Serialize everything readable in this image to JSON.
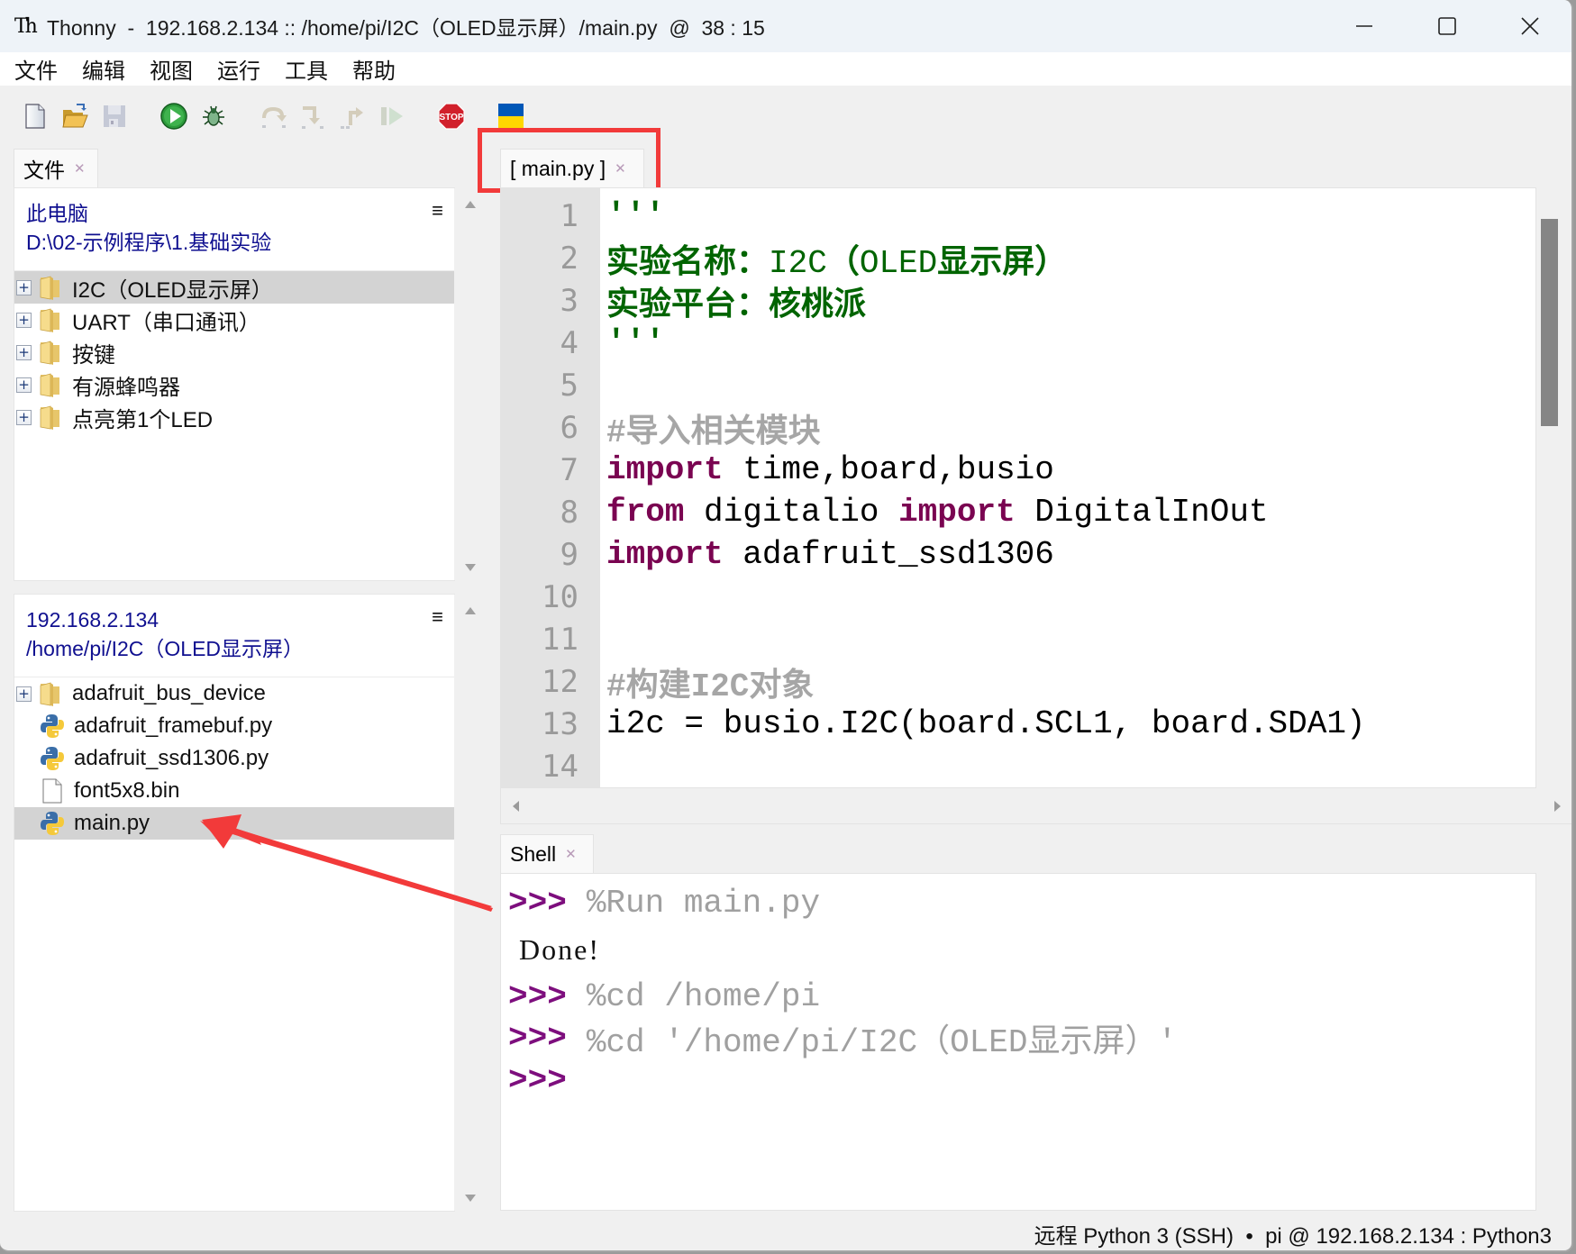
{
  "window": {
    "app_name": "Thonny",
    "title": "Thonny  -  192.168.2.134 :: /home/pi/I2C（OLED显示屏）/main.py  @  38 : 15",
    "controls": [
      "minimize",
      "maximize",
      "close"
    ]
  },
  "menu": [
    "文件",
    "编辑",
    "视图",
    "运行",
    "工具",
    "帮助"
  ],
  "toolbar": {
    "buttons": [
      {
        "name": "new-file",
        "icon": "new-file-icon",
        "enabled": true
      },
      {
        "name": "open-file",
        "icon": "open-folder-icon",
        "enabled": true
      },
      {
        "name": "save-file",
        "icon": "save-icon",
        "enabled": false
      },
      {
        "name": "run",
        "icon": "run-icon",
        "enabled": true
      },
      {
        "name": "debug",
        "icon": "bug-icon",
        "enabled": true
      },
      {
        "name": "step-over",
        "icon": "step-over-icon",
        "enabled": false
      },
      {
        "name": "step-into",
        "icon": "step-into-icon",
        "enabled": false
      },
      {
        "name": "step-out",
        "icon": "step-out-icon",
        "enabled": false
      },
      {
        "name": "resume",
        "icon": "resume-icon",
        "enabled": false
      },
      {
        "name": "stop",
        "icon": "stop-icon",
        "label": "STOP",
        "enabled": true
      },
      {
        "name": "ukraine-flag",
        "icon": "ukraine-flag-icon",
        "enabled": true
      }
    ]
  },
  "files_panel": {
    "tab_label": "文件",
    "local": {
      "title": "此电脑",
      "path": "D:\\02-示例程序\\1.基础实验",
      "items": [
        {
          "name": "I2C（OLED显示屏）",
          "type": "folder",
          "expandable": true,
          "selected": true
        },
        {
          "name": "UART（串口通讯）",
          "type": "folder",
          "expandable": true,
          "selected": false
        },
        {
          "name": "按键",
          "type": "folder",
          "expandable": true,
          "selected": false
        },
        {
          "name": "有源蜂鸣器",
          "type": "folder",
          "expandable": true,
          "selected": false
        },
        {
          "name": "点亮第1个LED",
          "type": "folder",
          "expandable": true,
          "selected": false
        }
      ]
    },
    "remote": {
      "title": "192.168.2.134",
      "path": "/home/pi/I2C（OLED显示屏）",
      "items": [
        {
          "name": "adafruit_bus_device",
          "type": "folder",
          "expandable": true,
          "selected": false
        },
        {
          "name": "adafruit_framebuf.py",
          "type": "python",
          "expandable": false,
          "selected": false
        },
        {
          "name": "adafruit_ssd1306.py",
          "type": "python",
          "expandable": false,
          "selected": false
        },
        {
          "name": "font5x8.bin",
          "type": "file",
          "expandable": false,
          "selected": false
        },
        {
          "name": "main.py",
          "type": "python",
          "expandable": false,
          "selected": true
        }
      ]
    },
    "menu_icon": "≡"
  },
  "editor": {
    "tab_label": "[ main.py ]",
    "lines": [
      {
        "n": "1",
        "tokens": [
          {
            "t": "'''",
            "c": "str"
          }
        ]
      },
      {
        "n": "2",
        "tokens": [
          {
            "t": "实验名称：",
            "c": "str"
          },
          {
            "t": "I2C",
            "c": "str-plain"
          },
          {
            "t": "（",
            "c": "str"
          },
          {
            "t": "OLED",
            "c": "str-plain"
          },
          {
            "t": "显示屏）",
            "c": "str"
          }
        ]
      },
      {
        "n": "3",
        "tokens": [
          {
            "t": "实验平台：核桃派",
            "c": "str"
          }
        ]
      },
      {
        "n": "4",
        "tokens": [
          {
            "t": "'''",
            "c": "str"
          }
        ]
      },
      {
        "n": "5",
        "tokens": []
      },
      {
        "n": "6",
        "tokens": [
          {
            "t": "#导入相关模块",
            "c": "cm"
          }
        ]
      },
      {
        "n": "7",
        "tokens": [
          {
            "t": "import",
            "c": "kw"
          },
          {
            "t": " time,board,busio",
            "c": ""
          }
        ]
      },
      {
        "n": "8",
        "tokens": [
          {
            "t": "from",
            "c": "kw"
          },
          {
            "t": " digitalio ",
            "c": ""
          },
          {
            "t": "import",
            "c": "kw"
          },
          {
            "t": " DigitalInOut",
            "c": ""
          }
        ]
      },
      {
        "n": "9",
        "tokens": [
          {
            "t": "import",
            "c": "kw"
          },
          {
            "t": " adafruit_ssd1306",
            "c": ""
          }
        ]
      },
      {
        "n": "10",
        "tokens": []
      },
      {
        "n": "11",
        "tokens": []
      },
      {
        "n": "12",
        "tokens": [
          {
            "t": "#构建I2C对象",
            "c": "cm"
          }
        ]
      },
      {
        "n": "13",
        "tokens": [
          {
            "t": "i2c = busio.I2C(board.SCL1, board.SDA1)",
            "c": ""
          }
        ]
      },
      {
        "n": "14",
        "tokens": []
      }
    ]
  },
  "shell": {
    "tab_label": "Shell",
    "prompt": ">>>",
    "lines": [
      {
        "type": "cmd",
        "text": "%Run main.py"
      },
      {
        "type": "out",
        "text": "Done!"
      },
      {
        "type": "cmd",
        "text": "%cd /home/pi"
      },
      {
        "type": "cmd",
        "text": "%cd '/home/pi/I2C（OLED显示屏）'"
      },
      {
        "type": "cmd",
        "text": ""
      }
    ]
  },
  "status_bar": {
    "text": "远程 Python 3 (SSH)  •  pi @ 192.168.2.134 : Python3"
  },
  "annotations": {
    "highlight_color": "#f23a3a",
    "highlight_target": "editor-tab",
    "arrow_target": "main.py"
  }
}
